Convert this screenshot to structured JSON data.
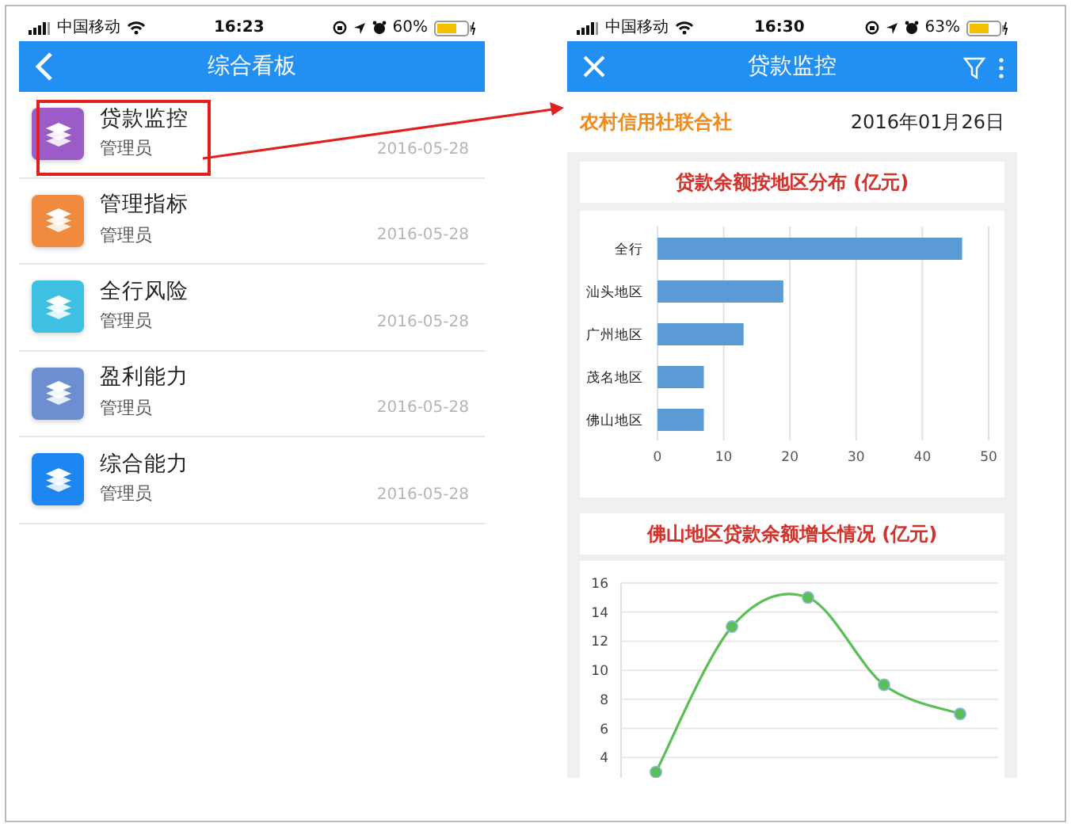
{
  "left_phone": {
    "status_bar": {
      "carrier": "中国移动",
      "time": "16:23",
      "battery": "60%"
    },
    "nav": {
      "title": "综合看板"
    },
    "items": [
      {
        "title": "贷款监控",
        "subtitle": "管理员",
        "date": "2016-05-28",
        "color": "#9b5cc8",
        "highlighted": true
      },
      {
        "title": "管理指标",
        "subtitle": "管理员",
        "date": "2016-05-28",
        "color": "#ef8a3e",
        "highlighted": false
      },
      {
        "title": "全行风险",
        "subtitle": "管理员",
        "date": "2016-05-28",
        "color": "#3ec0e2",
        "highlighted": false
      },
      {
        "title": "盈利能力",
        "subtitle": "管理员",
        "date": "2016-05-28",
        "color": "#6d8fd2",
        "highlighted": false
      },
      {
        "title": "综合能力",
        "subtitle": "管理员",
        "date": "2016-05-28",
        "color": "#1e86f0",
        "highlighted": false
      }
    ]
  },
  "right_phone": {
    "status_bar": {
      "carrier": "中国移动",
      "time": "16:30",
      "battery": "63%"
    },
    "nav": {
      "title": "贷款监控"
    },
    "org": "农村信用社联合社",
    "date": "2016年01月26日",
    "bar_panel": {
      "title": "贷款余额按地区分布 (亿元)",
      "chart_data": {
        "type": "bar",
        "orientation": "horizontal",
        "categories": [
          "全行",
          "汕头地区",
          "广州地区",
          "茂名地区",
          "佛山地区"
        ],
        "series": [
          {
            "color": "#5b9bd5",
            "values": [
              46,
              19,
              13,
              7,
              7
            ]
          }
        ],
        "xlim": [
          0,
          50
        ],
        "xticks": [
          0,
          10,
          20,
          30,
          40,
          50
        ],
        "grid": true
      }
    },
    "line_panel": {
      "title": "佛山地区贷款余额增长情况 (亿元)",
      "chart_data": {
        "type": "line",
        "series": [
          {
            "color": "#5cbf55",
            "values": [
              3,
              13,
              15,
              9,
              7
            ],
            "marker": true
          }
        ],
        "ylim": [
          2.6,
          16
        ],
        "yticks": [
          4,
          6,
          8,
          10,
          12,
          14,
          16
        ],
        "grid": true
      }
    }
  }
}
